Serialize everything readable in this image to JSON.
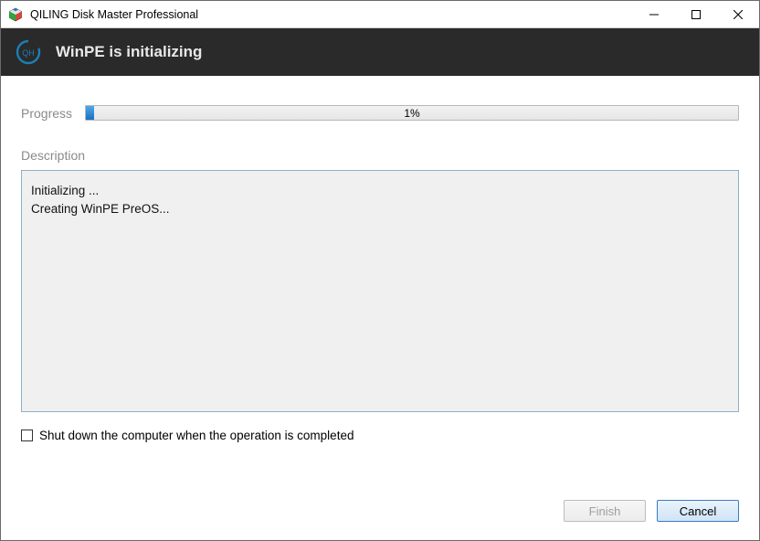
{
  "titlebar": {
    "title": "QILING Disk Master Professional"
  },
  "header": {
    "heading": "WinPE is initializing"
  },
  "progress": {
    "label": "Progress",
    "percent_text": "1%",
    "percent_value": 1
  },
  "description": {
    "label": "Description",
    "log": "Initializing ...\nCreating WinPE PreOS..."
  },
  "shutdown_checkbox": {
    "label": "Shut down the computer when the operation is completed",
    "checked": false
  },
  "buttons": {
    "finish": "Finish",
    "cancel": "Cancel"
  }
}
